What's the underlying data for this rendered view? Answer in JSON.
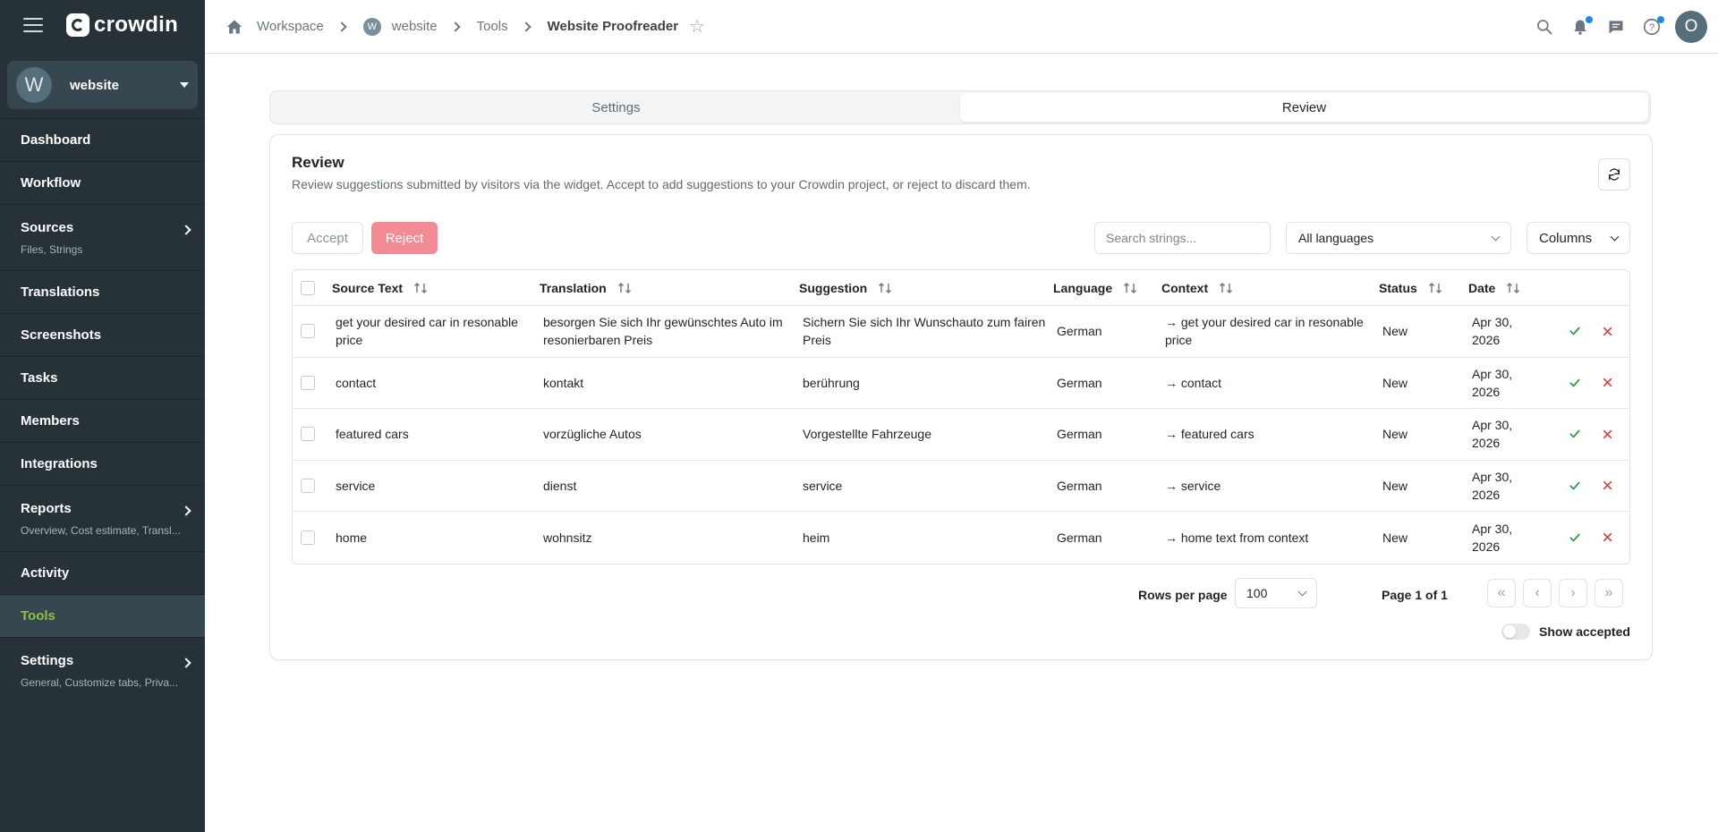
{
  "app": {
    "brand": "crowdin",
    "accent": "#8bc34a"
  },
  "project": {
    "avatar_letter": "W",
    "name": "website"
  },
  "sidebar": {
    "items": [
      {
        "label": "Dashboard",
        "sub": ""
      },
      {
        "label": "Workflow",
        "sub": ""
      },
      {
        "label": "Sources",
        "sub": "Files, Strings",
        "expandable": true
      },
      {
        "label": "Translations",
        "sub": ""
      },
      {
        "label": "Screenshots",
        "sub": ""
      },
      {
        "label": "Tasks",
        "sub": ""
      },
      {
        "label": "Members",
        "sub": ""
      },
      {
        "label": "Integrations",
        "sub": ""
      },
      {
        "label": "Reports",
        "sub": "Overview, Cost estimate, Transl...",
        "expandable": true
      },
      {
        "label": "Activity",
        "sub": ""
      },
      {
        "label": "Tools",
        "sub": "",
        "active": true
      },
      {
        "label": "Settings",
        "sub": "General, Customize tabs, Priva...",
        "expandable": true
      }
    ]
  },
  "breadcrumb": {
    "workspace": "Workspace",
    "project_badge": "W",
    "project": "website",
    "tools": "Tools",
    "current": "Website Proofreader"
  },
  "user": {
    "avatar_letter": "O"
  },
  "tabs": {
    "settings": "Settings",
    "review": "Review",
    "active": "review"
  },
  "review": {
    "title": "Review",
    "description": "Review suggestions submitted by visitors via the widget. Accept to add suggestions to your Crowdin project, or reject to discard them.",
    "accept_label": "Accept",
    "reject_label": "Reject",
    "search_placeholder": "Search strings...",
    "language_filter": "All languages",
    "columns_label": "Columns"
  },
  "table": {
    "headers": {
      "source": "Source Text",
      "translation": "Translation",
      "suggestion": "Suggestion",
      "language": "Language",
      "context": "Context",
      "status": "Status",
      "date": "Date"
    },
    "rows": [
      {
        "source": "get your desired car in resonable price",
        "translation": "besorgen Sie sich Ihr gewünschtes Auto im resonierbaren Preis",
        "suggestion": "Sichern Sie sich Ihr Wunschauto zum fairen Preis",
        "language": "German",
        "context": "→ get your desired car in resonable price",
        "status": "New",
        "date": "Apr 30, 2026"
      },
      {
        "source": "contact",
        "translation": "kontakt",
        "suggestion": "berührung",
        "language": "German",
        "context": "→ contact",
        "status": "New",
        "date": "Apr 30, 2026"
      },
      {
        "source": "featured cars",
        "translation": "vorzügliche Autos",
        "suggestion": "Vorgestellte Fahrzeuge",
        "language": "German",
        "context": "→ featured cars",
        "status": "New",
        "date": "Apr 30, 2026"
      },
      {
        "source": "service",
        "translation": "dienst",
        "suggestion": "service",
        "language": "German",
        "context": "→ service",
        "status": "New",
        "date": "Apr 30, 2026"
      },
      {
        "source": "home",
        "translation": "wohnsitz",
        "suggestion": "heim",
        "language": "German",
        "context": "→ home text from context",
        "status": "New",
        "date": "Apr 30, 2026"
      }
    ]
  },
  "pagination": {
    "rows_per_page_label": "Rows per page",
    "rows_per_page": "100",
    "page_info": "Page 1 of 1",
    "show_accepted_label": "Show accepted",
    "show_accepted": false
  },
  "colors": {
    "accept": "#2e9e44",
    "reject": "#e53935",
    "reject_button": "#f28b93",
    "notification_dot": "#1e88e5"
  }
}
